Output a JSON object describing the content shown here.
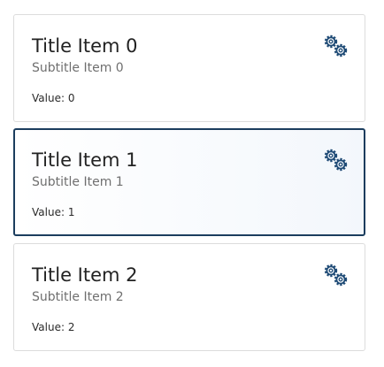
{
  "items": [
    {
      "title": "Title Item 0",
      "subtitle": "Subtitle Item 0",
      "value_label": "Value:",
      "value": "0",
      "icon": "gears-icon",
      "selected": false
    },
    {
      "title": "Title Item 1",
      "subtitle": "Subtitle Item 1",
      "value_label": "Value:",
      "value": "1",
      "icon": "gears-icon",
      "selected": true
    },
    {
      "title": "Title Item 2",
      "subtitle": "Subtitle Item 2",
      "value_label": "Value:",
      "value": "2",
      "icon": "gears-icon",
      "selected": false
    }
  ],
  "colors": {
    "accent": "#1b3d5e",
    "icon": "#1e4a75",
    "border": "#dcdcdc"
  }
}
